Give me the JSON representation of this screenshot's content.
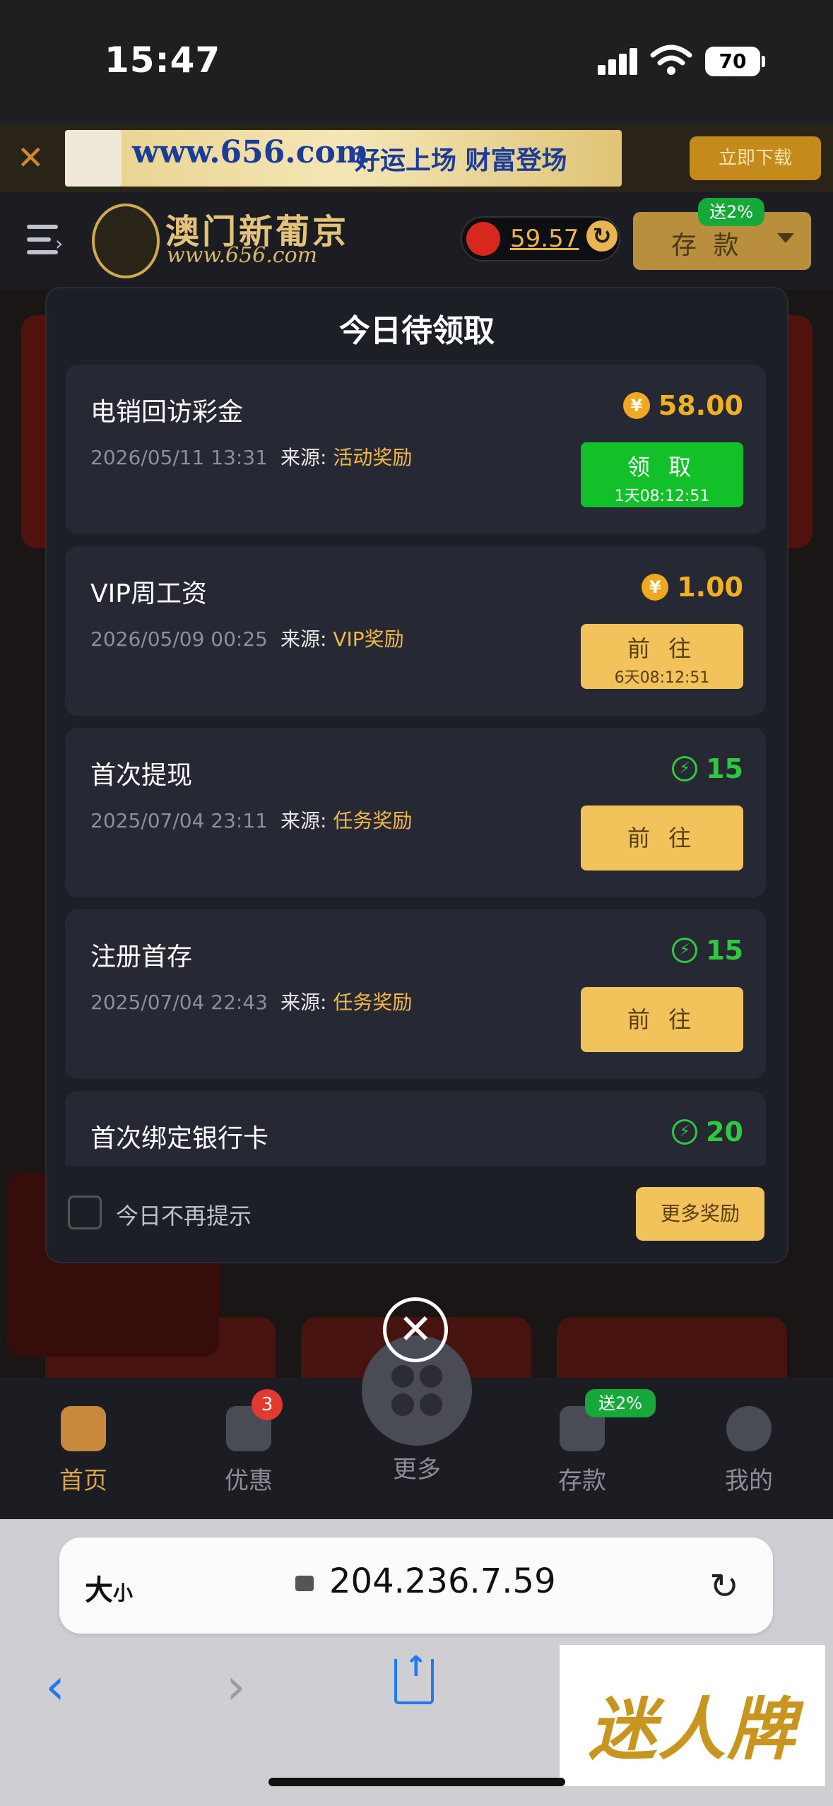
{
  "status_bar": {
    "time": "15:47",
    "battery": "70"
  },
  "top_banner": {
    "url_text": "www.656.com",
    "slogan": "好运上场 财富登场",
    "download_label": "立即下载"
  },
  "header": {
    "brand": "澳门新葡京",
    "brand_url": "www.656.com",
    "balance": "59.57",
    "deposit_label": "存 款",
    "deposit_badge": "送2%"
  },
  "modal": {
    "title": "今日待领取",
    "rewards": [
      {
        "title": "电销回访彩金",
        "date": "2026/05/11 13:31",
        "source_label": "来源:",
        "source": "活动奖励",
        "amount": "58.00",
        "amount_icon": "yuan-coin-icon",
        "button_label": "领 取",
        "button_sub": "1天08:12:51",
        "button_style": "green"
      },
      {
        "title": "VIP周工资",
        "date": "2026/05/09 00:25",
        "source_label": "来源:",
        "source": "VIP奖励",
        "amount": "1.00",
        "amount_icon": "yuan-coin-icon",
        "button_label": "前 往",
        "button_sub": "6天08:12:51",
        "button_style": "gold"
      },
      {
        "title": "首次提现",
        "date": "2025/07/04 23:11",
        "source_label": "来源:",
        "source": "任务奖励",
        "amount": "15",
        "amount_icon": "lightning-icon",
        "button_label": "前 往",
        "button_sub": "",
        "button_style": "gold"
      },
      {
        "title": "注册首存",
        "date": "2025/07/04 22:43",
        "source_label": "来源:",
        "source": "任务奖励",
        "amount": "15",
        "amount_icon": "lightning-icon",
        "button_label": "前 往",
        "button_sub": "",
        "button_style": "gold"
      },
      {
        "title": "首次绑定银行卡",
        "date": "",
        "source_label": "",
        "source": "",
        "amount": "20",
        "amount_icon": "lightning-icon",
        "button_label": "",
        "button_sub": "",
        "button_style": "gold"
      }
    ],
    "dont_show_label": "今日不再提示",
    "more_rewards_label": "更多奖励"
  },
  "bottom_nav": {
    "items": [
      {
        "label": "首页",
        "active": true
      },
      {
        "label": "优惠",
        "badge": "3"
      },
      {
        "label": "更多"
      },
      {
        "label": "存款",
        "badge": "送2%"
      },
      {
        "label": "我的"
      }
    ]
  },
  "browser": {
    "text_size_label": "大",
    "text_size_small": "小",
    "url": "204.236.7.59"
  },
  "watermark": {
    "text": "迷人牌"
  },
  "colors": {
    "accent_gold": "#f1c35a",
    "claim_green": "#12c12a",
    "amount_orange": "#f0b020",
    "lightning_green": "#2fc83f"
  }
}
